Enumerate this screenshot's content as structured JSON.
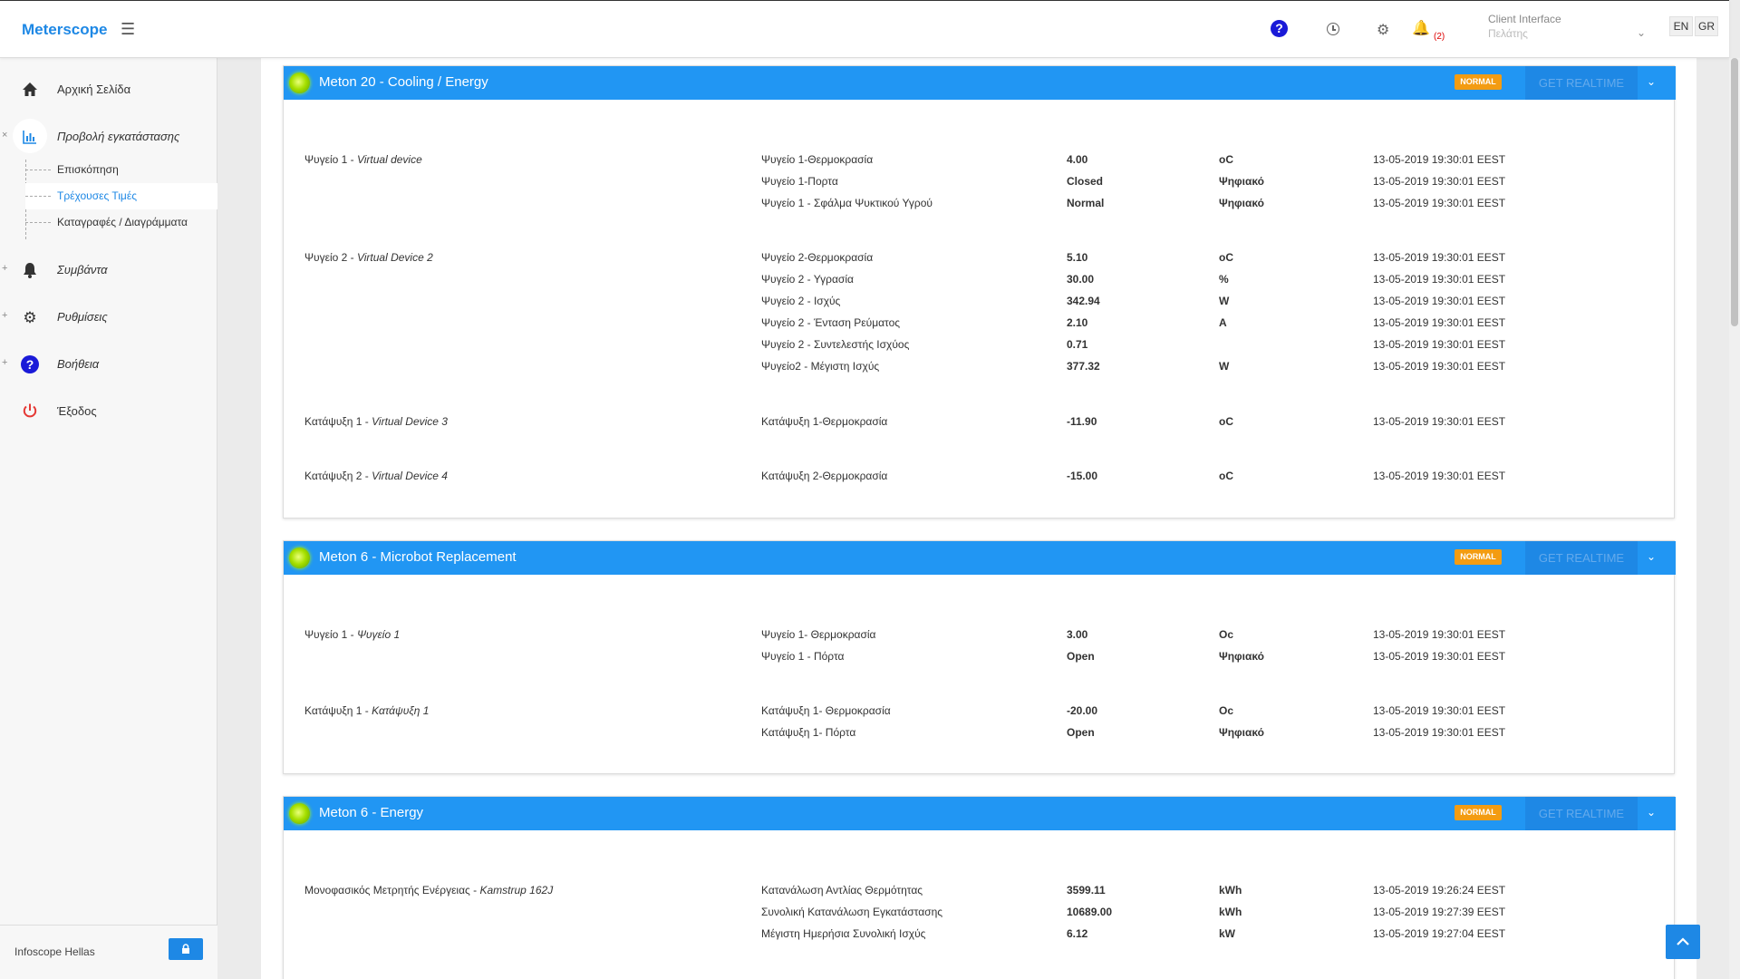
{
  "header": {
    "brand": "Meterscope",
    "bell_count": "(2)",
    "client_title": "Client Interface",
    "client_sub": "Πελάτης",
    "lang_en": "EN",
    "lang_gr": "GR"
  },
  "sidebar": {
    "home": "Αρχική Σελίδα",
    "installation": "Προβολή εγκατάστασης",
    "sub_overview": "Επισκόπηση",
    "sub_current": "Τρέχουσες Τιμές",
    "sub_logs": "Καταγραφές / Διαγράμματα",
    "events": "Συμβάντα",
    "settings": "Ρυθμίσεις",
    "help": "Βοήθεια",
    "logout": "Έξοδος",
    "footer": "Infoscope Hellas"
  },
  "panels": {
    "p1": {
      "title": "Meton 20 - Cooling / Energy",
      "badge": "NORMAL",
      "realtime": "GET REALTIME",
      "devices": [
        {
          "name": "Ψυγείο 1 - ",
          "sub": "Virtual device"
        },
        {
          "name": "Ψυγείο 2 - ",
          "sub": "Virtual Device 2"
        },
        {
          "name": "Κατάψυξη 1 - ",
          "sub": "Virtual Device 3"
        },
        {
          "name": "Κατάψυξη 2 - ",
          "sub": "Virtual Device 4"
        }
      ],
      "rows": [
        {
          "name": "Ψυγείο 1-Θερμοκρασία",
          "val": "4.00",
          "unit": "oC",
          "ts": "13-05-2019 19:30:01 EEST"
        },
        {
          "name": "Ψυγείο 1-Πορτα",
          "val": "Closed",
          "unit": "Ψηφιακό",
          "ts": "13-05-2019 19:30:01 EEST"
        },
        {
          "name": "Ψυγείο 1 - Σφάλμα Ψυκτικού Υγρού",
          "val": "Normal",
          "unit": "Ψηφιακό",
          "ts": "13-05-2019 19:30:01 EEST"
        },
        {
          "name": "Ψυγείο 2-Θερμοκρασία",
          "val": "5.10",
          "unit": "oC",
          "ts": "13-05-2019 19:30:01 EEST"
        },
        {
          "name": "Ψυγείο 2 - Υγρασία",
          "val": "30.00",
          "unit": "%",
          "ts": "13-05-2019 19:30:01 EEST"
        },
        {
          "name": "Ψυγείο 2 - Ισχύς",
          "val": "342.94",
          "unit": "W",
          "ts": "13-05-2019 19:30:01 EEST"
        },
        {
          "name": "Ψυγείο 2 - Ένταση Ρεύματος",
          "val": "2.10",
          "unit": "A",
          "ts": "13-05-2019 19:30:01 EEST"
        },
        {
          "name": "Ψυγείο 2 - Συντελεστής Ισχύος",
          "val": "0.71",
          "unit": "",
          "ts": "13-05-2019 19:30:01 EEST"
        },
        {
          "name": "Ψυγείο2 - Μέγιστη Ισχύς",
          "val": "377.32",
          "unit": "W",
          "ts": "13-05-2019 19:30:01 EEST"
        },
        {
          "name": "Κατάψυξη 1-Θερμοκρασία",
          "val": "-11.90",
          "unit": "oC",
          "ts": "13-05-2019 19:30:01 EEST"
        },
        {
          "name": "Κατάψυξη 2-Θερμοκρασία",
          "val": "-15.00",
          "unit": "oC",
          "ts": "13-05-2019 19:30:01 EEST"
        }
      ]
    },
    "p2": {
      "title": "Meton 6 - Microbot Replacement",
      "badge": "NORMAL",
      "realtime": "GET REALTIME",
      "devices": [
        {
          "name": "Ψυγείο 1 - ",
          "sub": "Ψυγείο 1"
        },
        {
          "name": "Κατάψυξη 1 - ",
          "sub": "Κατάψυξη 1"
        }
      ],
      "rows": [
        {
          "name": "Ψυγείο 1- Θερμοκρασία",
          "val": "3.00",
          "unit": "Oc",
          "ts": "13-05-2019 19:30:01 EEST"
        },
        {
          "name": "Ψυγείο 1 - Πόρτα",
          "val": "Open",
          "unit": "Ψηφιακό",
          "ts": "13-05-2019 19:30:01 EEST"
        },
        {
          "name": "Κατάψυξη 1- Θερμοκρασία",
          "val": "-20.00",
          "unit": "Oc",
          "ts": "13-05-2019 19:30:01 EEST"
        },
        {
          "name": "Κατάψυξη 1- Πόρτα",
          "val": "Open",
          "unit": "Ψηφιακό",
          "ts": "13-05-2019 19:30:01 EEST"
        }
      ]
    },
    "p3": {
      "title": "Meton 6 - Energy",
      "badge": "NORMAL",
      "realtime": "GET REALTIME",
      "devices": [
        {
          "name": "Μονοφασικός Μετρητής Ενέργειας - ",
          "sub": "Kamstrup 162J"
        }
      ],
      "rows": [
        {
          "name": "Κατανάλωση Αντλίας Θερμότητας",
          "val": "3599.11",
          "unit": "kWh",
          "ts": "13-05-2019 19:26:24 EEST"
        },
        {
          "name": "Συνολική Κατανάλωση Εγκατάστασης",
          "val": "10689.00",
          "unit": "kWh",
          "ts": "13-05-2019 19:27:39 EEST"
        },
        {
          "name": "Μέγιστη Ημερήσια Συνολική Ισχύς",
          "val": "6.12",
          "unit": "kW",
          "ts": "13-05-2019 19:27:04 EEST"
        }
      ]
    }
  },
  "colors": {
    "accent": "#2196f3",
    "badge": "#f39c12",
    "alert": "#dd0000"
  }
}
